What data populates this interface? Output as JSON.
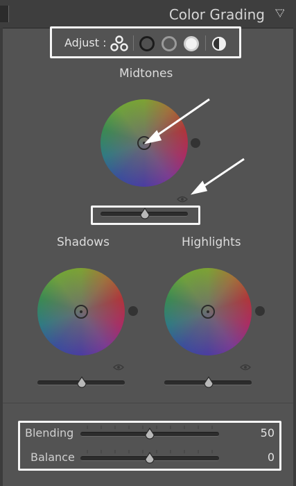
{
  "header": {
    "title": "Color Grading"
  },
  "adjust": {
    "label": "Adjust :",
    "modes": [
      "three-way",
      "shadows",
      "midtones",
      "highlights",
      "global"
    ]
  },
  "midtones": {
    "label": "Midtones"
  },
  "shadows": {
    "label": "Shadows"
  },
  "highlights": {
    "label": "Highlights"
  },
  "blending": {
    "label": "Blending",
    "value": "50"
  },
  "balance": {
    "label": "Balance",
    "value": "0"
  },
  "colors": {
    "highlight_box": "#f5f5f5",
    "panel": "#535353",
    "header": "#3e3e3e"
  },
  "icons": [
    "three-circles-icon",
    "shadows-circle-icon",
    "midtones-circle-icon",
    "highlights-circle-icon",
    "global-half-circle-icon",
    "eye-icon",
    "collapse-triangle-icon"
  ]
}
